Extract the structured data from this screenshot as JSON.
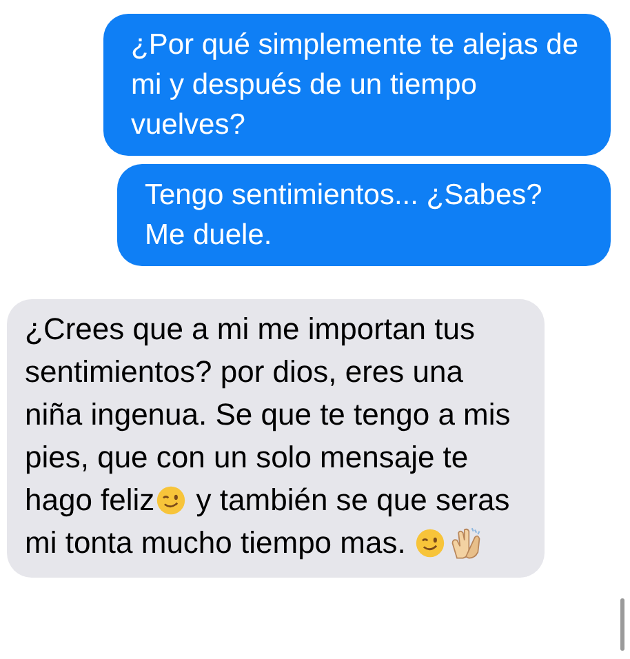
{
  "messages": [
    {
      "kind": "outgoing",
      "parts": [
        {
          "kind": "text",
          "text": "¿Por qué simplemente te alejas de mi y después de un tiempo vuelves?"
        }
      ]
    },
    {
      "kind": "outgoing",
      "parts": [
        {
          "kind": "text",
          "text": "Tengo sentimientos... ¿Sabes? Me duele."
        }
      ]
    },
    {
      "kind": "incoming",
      "parts": [
        {
          "kind": "text",
          "text": "¿Crees que a mi me importan tus sentimientos? por dios, eres una niña ingenua. Se que te tengo a mis pies, que con un solo mensaje te hago feliz"
        },
        {
          "kind": "wink"
        },
        {
          "kind": "text",
          "text": " y también se que seras mi tonta mucho tiempo mas. "
        },
        {
          "kind": "wink"
        },
        {
          "kind": "clap"
        }
      ]
    }
  ]
}
